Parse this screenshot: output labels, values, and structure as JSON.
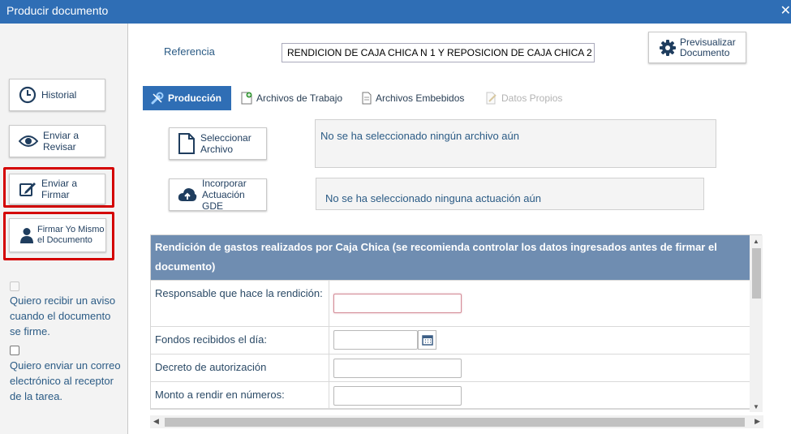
{
  "window": {
    "title": "Producir documento",
    "close_glyph": "✕"
  },
  "sidebar": {
    "buttons": [
      {
        "label": "Historial",
        "icon": "clock-icon"
      },
      {
        "label": "Enviar a Revisar",
        "icon": "eye-icon"
      },
      {
        "label": "Enviar a Firmar",
        "icon": "edit-icon"
      },
      {
        "label": "Firmar Yo Mismo el Documento",
        "icon": "user-icon"
      }
    ],
    "checkboxes": [
      {
        "label": "Quiero recibir un aviso cuando el documento se firme.",
        "checked": false,
        "disabled": true
      },
      {
        "label": "Quiero enviar un correo electrónico al receptor de la tarea.",
        "checked": false,
        "disabled": false
      }
    ],
    "highlight_color": "#d40000"
  },
  "header": {
    "reference_label": "Referencia",
    "reference_value": "RENDICION DE CAJA CHICA N 1 Y REPOSICION DE CAJA CHICA 2",
    "preview_button": "Previsualizar Documento"
  },
  "tabs": [
    {
      "label": "Producción",
      "active": true,
      "icon": "wrench-icon"
    },
    {
      "label": "Archivos de Trabajo",
      "active": false,
      "icon": "file-add-icon"
    },
    {
      "label": "Archivos Embebidos",
      "active": false,
      "icon": "file-icon"
    },
    {
      "label": "Datos Propios",
      "active": false,
      "disabled": true,
      "icon": "file-edit-icon"
    }
  ],
  "production": {
    "select_file_button": "Seleccionar Archivo",
    "select_file_status": "No se ha seleccionado ningún archivo aún",
    "incorporate_button": "Incorporar Actuación GDE",
    "incorporate_status": "No se ha seleccionado ninguna actuación aún"
  },
  "form": {
    "title": "Rendición de gastos realizados por Caja Chica (se recomienda controlar los datos ingresados antes de firmar el documento)",
    "rows": [
      {
        "label": "Responsable que hace la rendición:",
        "value": ""
      },
      {
        "label": "Fondos recibidos el día:",
        "value": "",
        "type": "date"
      },
      {
        "label": "Decreto de autorización",
        "value": ""
      },
      {
        "label": "Monto a rendir en números:",
        "value": ""
      },
      {
        "label": "",
        "value": ""
      }
    ]
  },
  "colors": {
    "accent": "#2f6eb5",
    "form_header": "#6f8db1"
  }
}
